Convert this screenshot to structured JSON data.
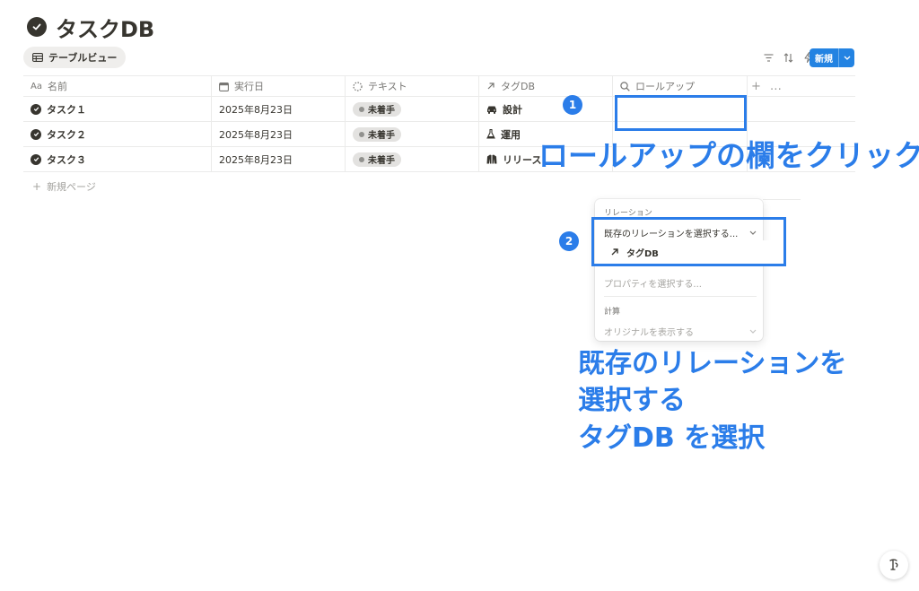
{
  "page": {
    "title": "タスクDB"
  },
  "view": {
    "tab_label": "テーブルビュー"
  },
  "toolbar": {
    "icons": [
      "filter-icon",
      "sort-icon",
      "lightning-icon",
      "search-icon",
      "settings-sliders-icon"
    ],
    "new_label": "新規"
  },
  "table": {
    "headers": [
      {
        "label": "名前",
        "icon": "Aa"
      },
      {
        "label": "実行日",
        "icon": "calendar-icon"
      },
      {
        "label": "テキスト",
        "icon": "status-icon"
      },
      {
        "label": "タグDB",
        "icon": "arrow-up-right-icon"
      },
      {
        "label": "ロールアップ",
        "icon": "search-icon"
      }
    ],
    "add_column": "+",
    "more": "…",
    "rows": [
      {
        "name": "タスク１",
        "date": "2025年8月23日",
        "status": "未着手",
        "tag": "設計",
        "tag_icon": "car-icon"
      },
      {
        "name": "タスク２",
        "date": "2025年8月23日",
        "status": "未着手",
        "tag": "運用",
        "tag_icon": "flask-icon"
      },
      {
        "name": "タスク３",
        "date": "2025年8月23日",
        "status": "未着手",
        "tag": "リリース",
        "tag_icon": "jacket-icon"
      }
    ],
    "new_page": "新規ページ"
  },
  "annotations": {
    "step1_badge": "1",
    "step1_text": "ロールアップの欄をクリック",
    "step2_badge": "2",
    "step2_text_line1": "既存のリレーションを",
    "step2_text_line2": "選択する",
    "step2_text_line3": "タグDB を選択",
    "accent_color": "#2b7de9"
  },
  "panel": {
    "relation_label": "リレーション",
    "relation_select": "既存のリレーションを選択する...",
    "relation_option": "タグDB",
    "property_placeholder": "プロパティを選択する...",
    "calc_label": "計算",
    "calc_select": "オリジナルを表示する"
  },
  "colors": {
    "primary": "#2383e2",
    "text": "#37352f",
    "muted": "#787774"
  }
}
